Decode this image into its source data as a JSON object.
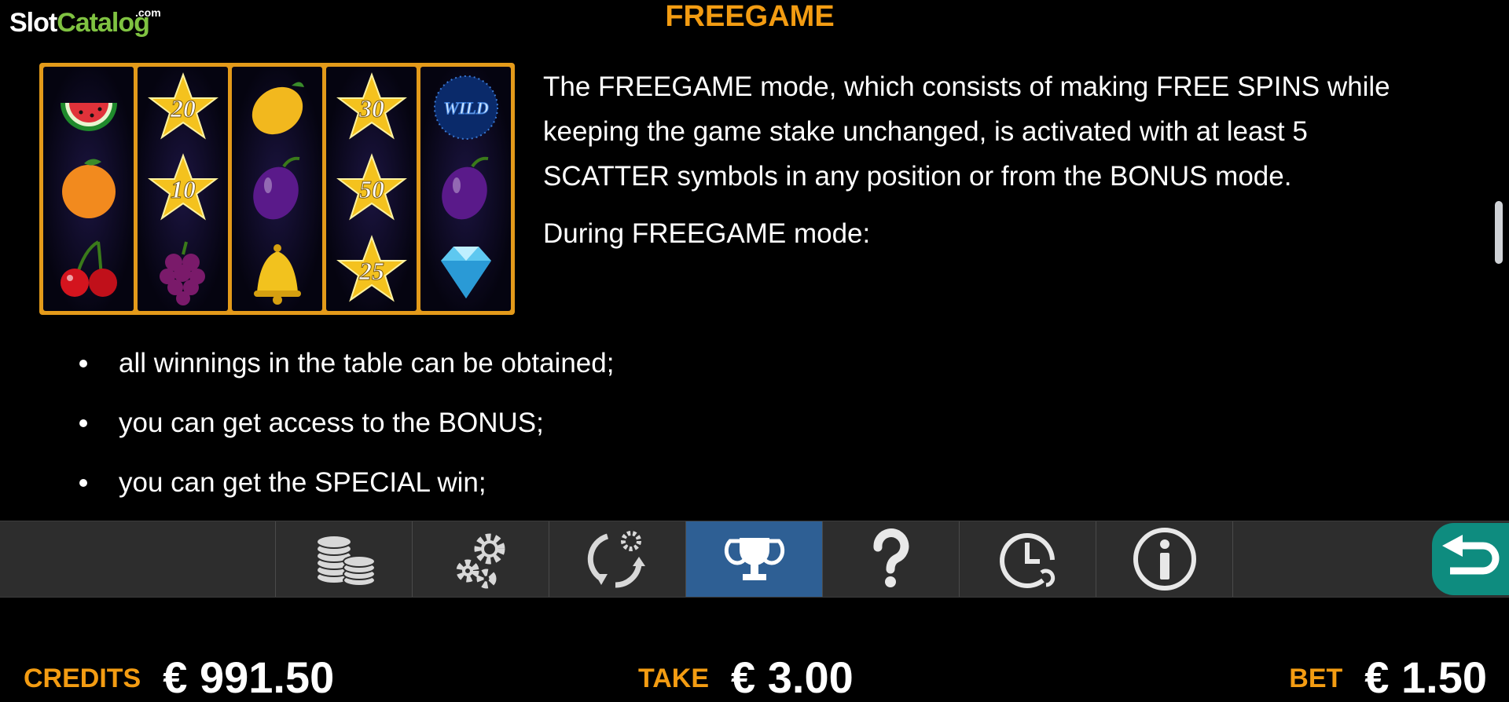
{
  "logo": {
    "slot": "Slot",
    "catalog": "Catalog",
    "com": ".com"
  },
  "title": "FREEGAME",
  "reels": [
    [
      {
        "icon": "watermelon-icon"
      },
      {
        "icon": "orange-icon"
      },
      {
        "icon": "cherries-icon"
      }
    ],
    [
      {
        "icon": "star-icon",
        "label": "20"
      },
      {
        "icon": "star-icon",
        "label": "10"
      },
      {
        "icon": "grapes-icon"
      }
    ],
    [
      {
        "icon": "lemon-icon"
      },
      {
        "icon": "plum-icon"
      },
      {
        "icon": "bell-icon"
      }
    ],
    [
      {
        "icon": "star-icon",
        "label": "30"
      },
      {
        "icon": "star-icon",
        "label": "50"
      },
      {
        "icon": "star-icon",
        "label": "25"
      }
    ],
    [
      {
        "icon": "wild-icon",
        "label": "WILD"
      },
      {
        "icon": "plum-icon"
      },
      {
        "icon": "diamond-icon"
      }
    ]
  ],
  "description": {
    "paragraph1": "The FREEGAME mode, which consists of making FREE SPINS while keeping the game stake unchanged, is activated with at least 5 SCATTER symbols in any position or from the BONUS mode.",
    "paragraph2": "During FREEGAME mode:"
  },
  "bullets": [
    "all winnings in the table can be obtained;",
    "you can get access to the BONUS;",
    "you can get the SPECIAL win;"
  ],
  "toolbar": {
    "buttons": [
      {
        "icon": "coins-icon"
      },
      {
        "icon": "gears-icon"
      },
      {
        "icon": "autoplay-icon"
      },
      {
        "icon": "trophy-icon",
        "active": true
      },
      {
        "icon": "question-icon"
      },
      {
        "icon": "history-icon"
      },
      {
        "icon": "info-icon"
      }
    ],
    "back_icon": "back-arrow-icon"
  },
  "footer": {
    "credits_label": "CREDITS",
    "credits_value": "€ 991.50",
    "take_label": "TAKE",
    "take_value": "€ 3.00",
    "bet_label": "BET",
    "bet_value": "€ 1.50"
  },
  "colors": {
    "accent": "#f39c12",
    "active_tab": "#2e5f94",
    "back_button": "#0e8c7f",
    "reel_frame": "#e39a1a"
  }
}
